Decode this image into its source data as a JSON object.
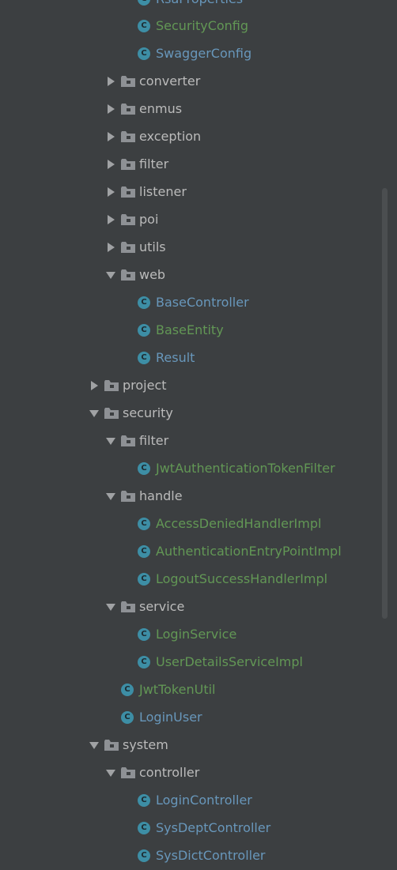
{
  "tree": {
    "items": [
      {
        "label": "RsaProperties",
        "kind": "class",
        "color": "blue"
      },
      {
        "label": "SecurityConfig",
        "kind": "class",
        "color": "green"
      },
      {
        "label": "SwaggerConfig",
        "kind": "class",
        "color": "blue"
      },
      {
        "label": "converter",
        "kind": "folder",
        "state": "collapsed"
      },
      {
        "label": "enmus",
        "kind": "folder",
        "state": "collapsed"
      },
      {
        "label": "exception",
        "kind": "folder",
        "state": "collapsed"
      },
      {
        "label": "filter",
        "kind": "folder",
        "state": "collapsed"
      },
      {
        "label": "listener",
        "kind": "folder",
        "state": "collapsed"
      },
      {
        "label": "poi",
        "kind": "folder",
        "state": "collapsed"
      },
      {
        "label": "utils",
        "kind": "folder",
        "state": "collapsed"
      },
      {
        "label": "web",
        "kind": "folder",
        "state": "expanded"
      },
      {
        "label": "BaseController",
        "kind": "class",
        "color": "blue"
      },
      {
        "label": "BaseEntity",
        "kind": "class",
        "color": "green"
      },
      {
        "label": "Result",
        "kind": "class",
        "color": "blue"
      },
      {
        "label": "project",
        "kind": "folder",
        "state": "collapsed"
      },
      {
        "label": "security",
        "kind": "folder",
        "state": "expanded"
      },
      {
        "label": "filter",
        "kind": "folder",
        "state": "expanded"
      },
      {
        "label": "JwtAuthenticationTokenFilter",
        "kind": "class",
        "color": "green"
      },
      {
        "label": "handle",
        "kind": "folder",
        "state": "expanded"
      },
      {
        "label": "AccessDeniedHandlerImpl",
        "kind": "class",
        "color": "green"
      },
      {
        "label": "AuthenticationEntryPointImpl",
        "kind": "class",
        "color": "green"
      },
      {
        "label": "LogoutSuccessHandlerImpl",
        "kind": "class",
        "color": "green"
      },
      {
        "label": "service",
        "kind": "folder",
        "state": "expanded"
      },
      {
        "label": "LoginService",
        "kind": "class",
        "color": "green"
      },
      {
        "label": "UserDetailsServiceImpl",
        "kind": "class",
        "color": "green"
      },
      {
        "label": "JwtTokenUtil",
        "kind": "class",
        "color": "green"
      },
      {
        "label": "LoginUser",
        "kind": "class",
        "color": "blue"
      },
      {
        "label": "system",
        "kind": "folder",
        "state": "expanded"
      },
      {
        "label": "controller",
        "kind": "folder",
        "state": "expanded"
      },
      {
        "label": "LoginController",
        "kind": "class",
        "color": "blue"
      },
      {
        "label": "SysDeptController",
        "kind": "class",
        "color": "blue"
      },
      {
        "label": "SysDictController",
        "kind": "class",
        "color": "blue"
      }
    ]
  },
  "class_icon_letter": "C",
  "colors": {
    "background": "#3c3f41",
    "folder_text": "#bbbbbb",
    "class_blue": "#6897bb",
    "class_green": "#629755",
    "class_icon": "#3d8ea5"
  }
}
